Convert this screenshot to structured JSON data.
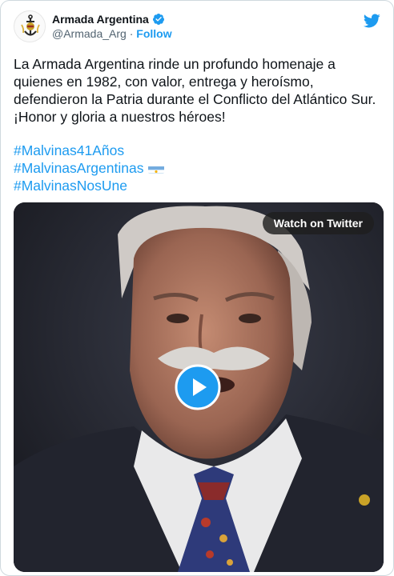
{
  "tweet": {
    "display_name": "Armada Argentina",
    "handle": "@Armada_Arg",
    "separator": "·",
    "follow_label": "Follow",
    "text_lines": [
      "La Armada Argentina rinde un profundo homenaje a",
      "quienes en 1982, con valor, entrega y heroísmo,",
      "defendieron la Patria durante el Conflicto del Atlántico Sur.",
      "¡Honor y gloria a nuestros héroes!"
    ],
    "hashtags": [
      "#Malvinas41Años",
      "#MalvinasArgentinas",
      "#MalvinasNosUne"
    ]
  },
  "video": {
    "watch_label": "Watch on Twitter"
  },
  "icons": {
    "verified": "verified-badge-icon",
    "twitter": "twitter-bird-icon",
    "play": "play-icon",
    "flag": "argentina-flag-icon"
  },
  "colors": {
    "accent": "#1d9bf0",
    "text": "#0f1419",
    "secondary": "#536471"
  }
}
